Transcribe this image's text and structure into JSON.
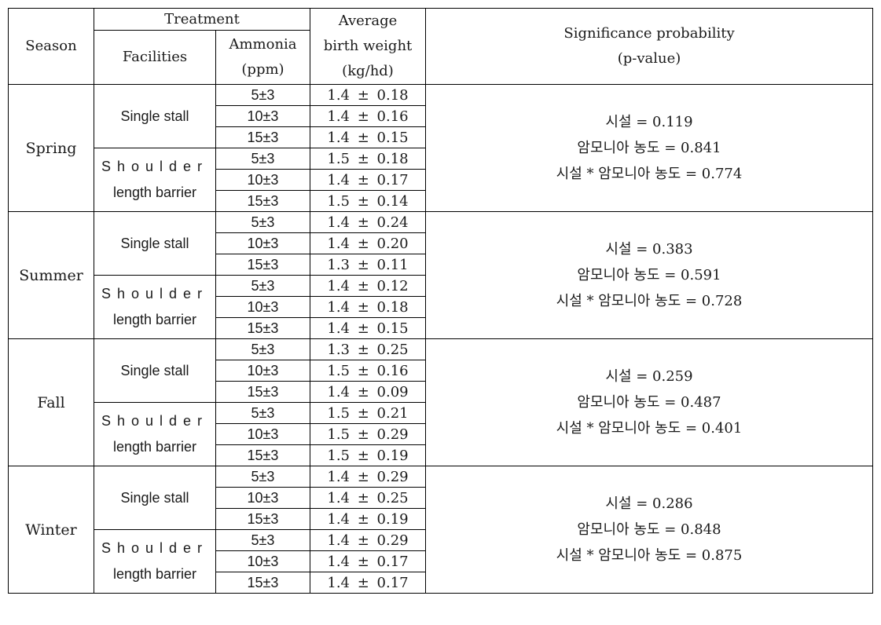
{
  "header": {
    "season": "Season",
    "treatment": "Treatment",
    "facilities": "Facilities",
    "ammonia_line1": "Ammonia",
    "ammonia_line2": "(ppm)",
    "birth_weight_line1": "Average",
    "birth_weight_line2": "birth weight",
    "birth_weight_line3": "(kg/hd)",
    "significance_line1": "Significance probability",
    "significance_line2": "(p-value)"
  },
  "seasons": [
    {
      "name": "Spring",
      "groups": [
        {
          "facility_line1": "Single stall",
          "facility_line2": "",
          "rows": [
            {
              "ammonia": "5±3",
              "weight": "1.4 ± 0.18"
            },
            {
              "ammonia": "10±3",
              "weight": "1.4 ± 0.16"
            },
            {
              "ammonia": "15±3",
              "weight": "1.4 ± 0.15"
            }
          ]
        },
        {
          "facility_line1": "Shoulder",
          "facility_line2": "length barrier",
          "rows": [
            {
              "ammonia": "5±3",
              "weight": "1.5 ± 0.18"
            },
            {
              "ammonia": "10±3",
              "weight": "1.4 ± 0.17"
            },
            {
              "ammonia": "15±3",
              "weight": "1.5 ± 0.14"
            }
          ]
        }
      ],
      "pvalues": [
        "시설 = 0.119",
        "암모니아 농도 = 0.841",
        "시설 * 암모니아 농도 = 0.774"
      ]
    },
    {
      "name": "Summer",
      "groups": [
        {
          "facility_line1": "Single stall",
          "facility_line2": "",
          "rows": [
            {
              "ammonia": "5±3",
              "weight": "1.4 ± 0.24"
            },
            {
              "ammonia": "10±3",
              "weight": "1.4 ± 0.20"
            },
            {
              "ammonia": "15±3",
              "weight": "1.3 ± 0.11"
            }
          ]
        },
        {
          "facility_line1": "Shoulder",
          "facility_line2": "length barrier",
          "rows": [
            {
              "ammonia": "5±3",
              "weight": "1.4 ± 0.12"
            },
            {
              "ammonia": "10±3",
              "weight": "1.4 ± 0.18"
            },
            {
              "ammonia": "15±3",
              "weight": "1.4 ± 0.15"
            }
          ]
        }
      ],
      "pvalues": [
        "시설 = 0.383",
        "암모니아 농도 = 0.591",
        "시설 * 암모니아 농도 = 0.728"
      ]
    },
    {
      "name": "Fall",
      "groups": [
        {
          "facility_line1": "Single stall",
          "facility_line2": "",
          "rows": [
            {
              "ammonia": "5±3",
              "weight": "1.3 ± 0.25"
            },
            {
              "ammonia": "10±3",
              "weight": "1.5 ± 0.16"
            },
            {
              "ammonia": "15±3",
              "weight": "1.4 ± 0.09"
            }
          ]
        },
        {
          "facility_line1": "Shoulder",
          "facility_line2": "length barrier",
          "rows": [
            {
              "ammonia": "5±3",
              "weight": "1.5 ± 0.21"
            },
            {
              "ammonia": "10±3",
              "weight": "1.5 ± 0.29"
            },
            {
              "ammonia": "15±3",
              "weight": "1.5 ± 0.19"
            }
          ]
        }
      ],
      "pvalues": [
        "시설 = 0.259",
        "암모니아 농도 = 0.487",
        "시설 * 암모니아 농도 = 0.401"
      ]
    },
    {
      "name": "Winter",
      "groups": [
        {
          "facility_line1": "Single stall",
          "facility_line2": "",
          "rows": [
            {
              "ammonia": "5±3",
              "weight": "1.4 ± 0.29"
            },
            {
              "ammonia": "10±3",
              "weight": "1.4 ± 0.25"
            },
            {
              "ammonia": "15±3",
              "weight": "1.4 ± 0.19"
            }
          ]
        },
        {
          "facility_line1": "Shoulder",
          "facility_line2": "length barrier",
          "rows": [
            {
              "ammonia": "5±3",
              "weight": "1.4 ± 0.29"
            },
            {
              "ammonia": "10±3",
              "weight": "1.4 ± 0.17"
            },
            {
              "ammonia": "15±3",
              "weight": "1.4 ± 0.17"
            }
          ]
        }
      ],
      "pvalues": [
        "시설 = 0.286",
        "암모니아 농도 = 0.848",
        "시설 * 암모니아 농도 = 0.875"
      ]
    }
  ]
}
